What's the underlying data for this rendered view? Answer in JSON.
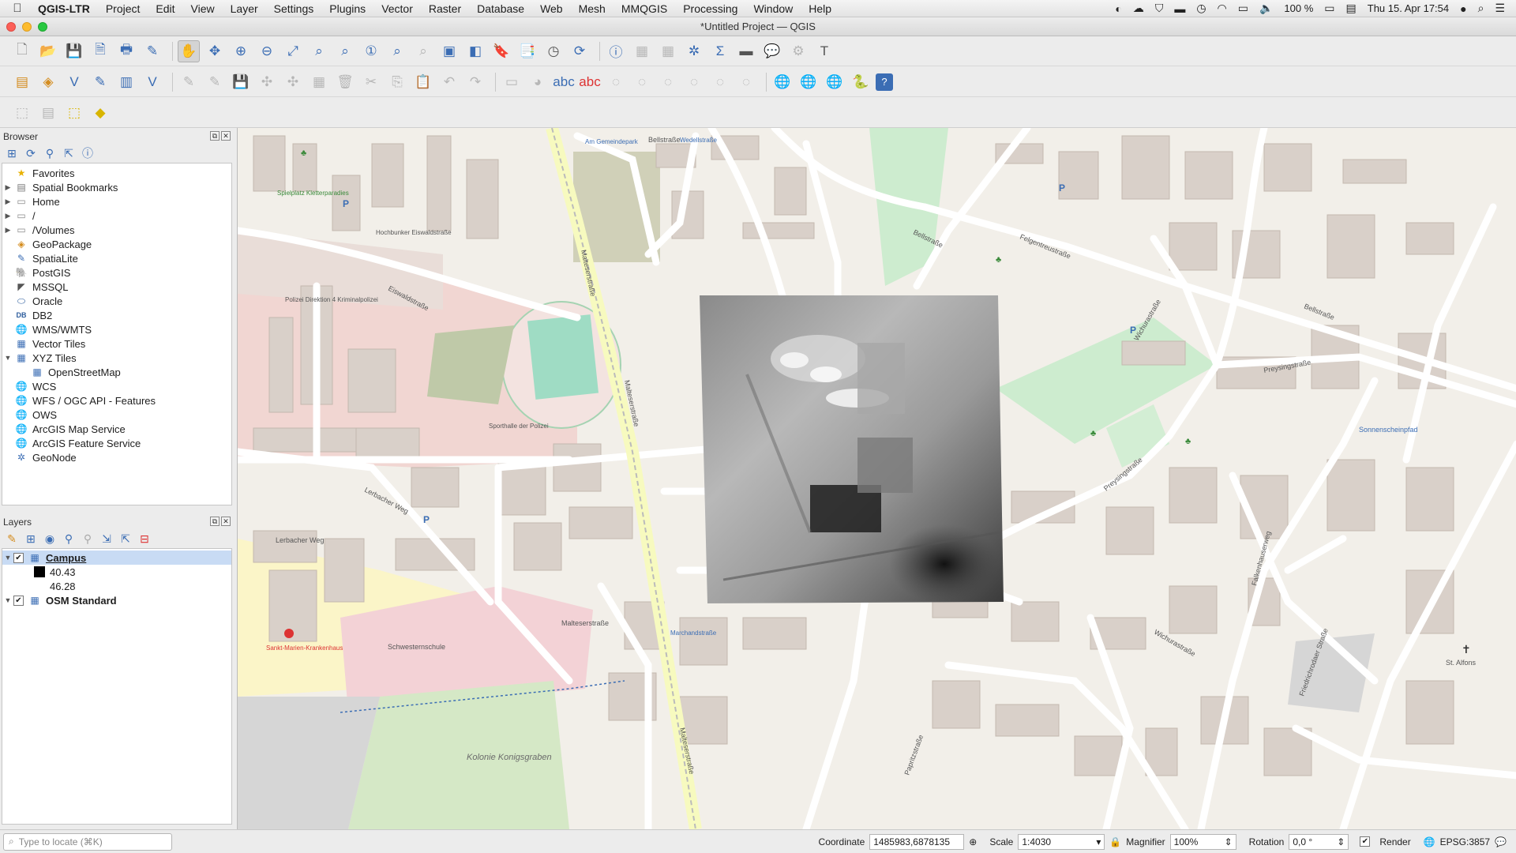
{
  "menubar": {
    "app_name": "QGIS-LTR",
    "items": [
      "Project",
      "Edit",
      "View",
      "Layer",
      "Settings",
      "Plugins",
      "Vector",
      "Raster",
      "Database",
      "Web",
      "Mesh",
      "MMQGIS",
      "Processing",
      "Window",
      "Help"
    ],
    "battery": "100 %",
    "clock": "Thu 15. Apr  17:54"
  },
  "window": {
    "title": "*Untitled Project — QGIS"
  },
  "browser": {
    "title": "Browser",
    "items": [
      {
        "label": "Favorites",
        "icon": "star-icon",
        "expandable": false
      },
      {
        "label": "Spatial Bookmarks",
        "icon": "bookmark-icon",
        "expandable": true
      },
      {
        "label": "Home",
        "icon": "folder-icon",
        "expandable": true
      },
      {
        "label": "/",
        "icon": "folder-icon",
        "expandable": true
      },
      {
        "label": "/Volumes",
        "icon": "folder-icon",
        "expandable": true
      },
      {
        "label": "GeoPackage",
        "icon": "geopackage-icon",
        "expandable": false
      },
      {
        "label": "SpatiaLite",
        "icon": "spatialite-icon",
        "expandable": false
      },
      {
        "label": "PostGIS",
        "icon": "postgis-icon",
        "expandable": false
      },
      {
        "label": "MSSQL",
        "icon": "mssql-icon",
        "expandable": false
      },
      {
        "label": "Oracle",
        "icon": "oracle-icon",
        "expandable": false
      },
      {
        "label": "DB2",
        "icon": "db2-icon",
        "expandable": false
      },
      {
        "label": "WMS/WMTS",
        "icon": "globe-icon",
        "expandable": false
      },
      {
        "label": "Vector Tiles",
        "icon": "grid-icon",
        "expandable": false
      },
      {
        "label": "XYZ Tiles",
        "icon": "grid-icon",
        "expandable": true,
        "expanded": true
      },
      {
        "label": "OpenStreetMap",
        "icon": "grid-icon",
        "expandable": false,
        "indent": true
      },
      {
        "label": "WCS",
        "icon": "globe-icon",
        "expandable": false
      },
      {
        "label": "WFS / OGC API - Features",
        "icon": "globe-icon",
        "expandable": false
      },
      {
        "label": "OWS",
        "icon": "globe-icon",
        "expandable": false
      },
      {
        "label": "ArcGIS Map Service",
        "icon": "globe-icon",
        "expandable": false
      },
      {
        "label": "ArcGIS Feature Service",
        "icon": "globe-icon",
        "expandable": false
      },
      {
        "label": "GeoNode",
        "icon": "geonode-icon",
        "expandable": false
      }
    ]
  },
  "layers": {
    "title": "Layers",
    "campus": {
      "name": "Campus",
      "min": "40.43",
      "max": "46.28"
    },
    "osm": {
      "name": "OSM Standard"
    }
  },
  "map_labels": {
    "bellstrasse": "Bellstraße",
    "eiswaldstrasse": "Eiswaldstraße",
    "maltesserstrasse": "Malteserstraße",
    "lerbacher_weg": "Lerbacher Weg",
    "polizei": "Polizei Direktion 4 Kriminalpolizei",
    "sporthalle": "Sporthalle der Polizei",
    "krankenhaus": "Sankt-Marien-Krankenhaus",
    "schwesternschule": "Schwesternschule",
    "kolonie": "Kolonie Konigsgraben",
    "wichurastrasse": "Wichurastraße",
    "preysingstrasse": "Preysingstraße",
    "friedrichrodaer": "Friedrichrodaer Straße",
    "falkenhauser": "Falkenhauserweg",
    "sonnenscheinpfad": "Sonnenscheinpfad",
    "st_alfons": "St. Alfons",
    "marchandstrasse": "Marchandstraße",
    "wedellstrasse": "Wedellstraße",
    "am_gemeindepark": "Am Gemeindepark",
    "papritzstrasse": "Papritzstraße",
    "felgentreustrasse": "Felgentreustraße",
    "spielplatz": "Spielplatz Kletterparadies",
    "hochbunker": "Hochbunker Eiswaldstraße"
  },
  "statusbar": {
    "locate_placeholder": "Type to locate (⌘K)",
    "coordinate_label": "Coordinate",
    "coordinate": "1485983,6878135",
    "scale_label": "Scale",
    "scale": "1:4030",
    "magnifier_label": "Magnifier",
    "magnifier": "100%",
    "rotation_label": "Rotation",
    "rotation": "0,0 °",
    "render_label": "Render",
    "crs": "EPSG:3857"
  }
}
